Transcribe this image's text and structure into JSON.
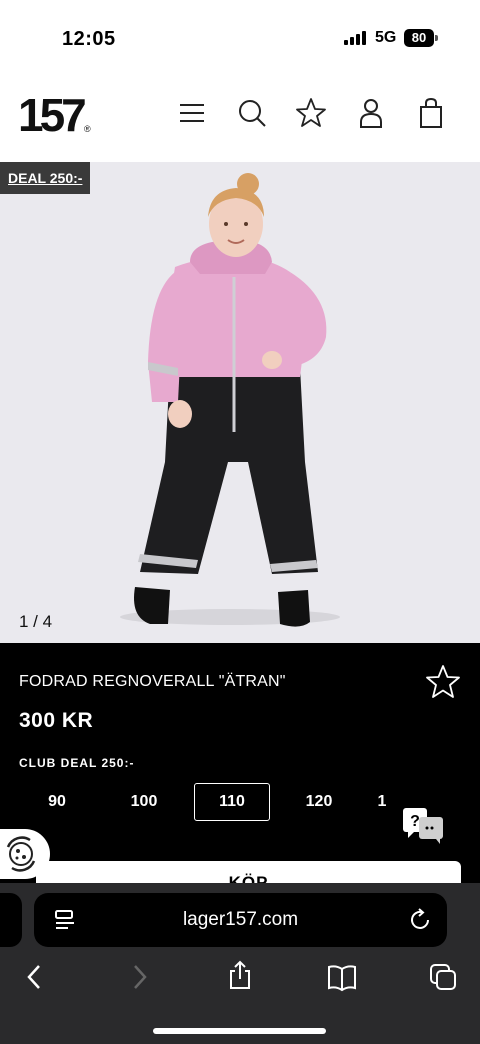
{
  "status": {
    "time": "12:05",
    "network": "5G",
    "battery": "80"
  },
  "header": {
    "logo": "157",
    "logo_mark": "®",
    "icons": [
      "menu-icon",
      "search-icon",
      "star-icon",
      "user-icon",
      "bag-icon"
    ]
  },
  "product": {
    "deal_badge": "DEAL 250:-",
    "image_counter": "1 / 4",
    "name": "FODRAD REGNOVERALL \"ÄTRAN\"",
    "price": "300 KR",
    "club_deal": "CLUB DEAL 250:-",
    "sizes": [
      "90",
      "100",
      "110",
      "120",
      "1"
    ],
    "selected_size": "110",
    "buy_label": "KÖP"
  },
  "browser": {
    "url": "lager157.com"
  },
  "colors": {
    "jacket_pink": "#e7a9cf",
    "trousers": "#1e1e20",
    "background": "#eae9ee"
  }
}
